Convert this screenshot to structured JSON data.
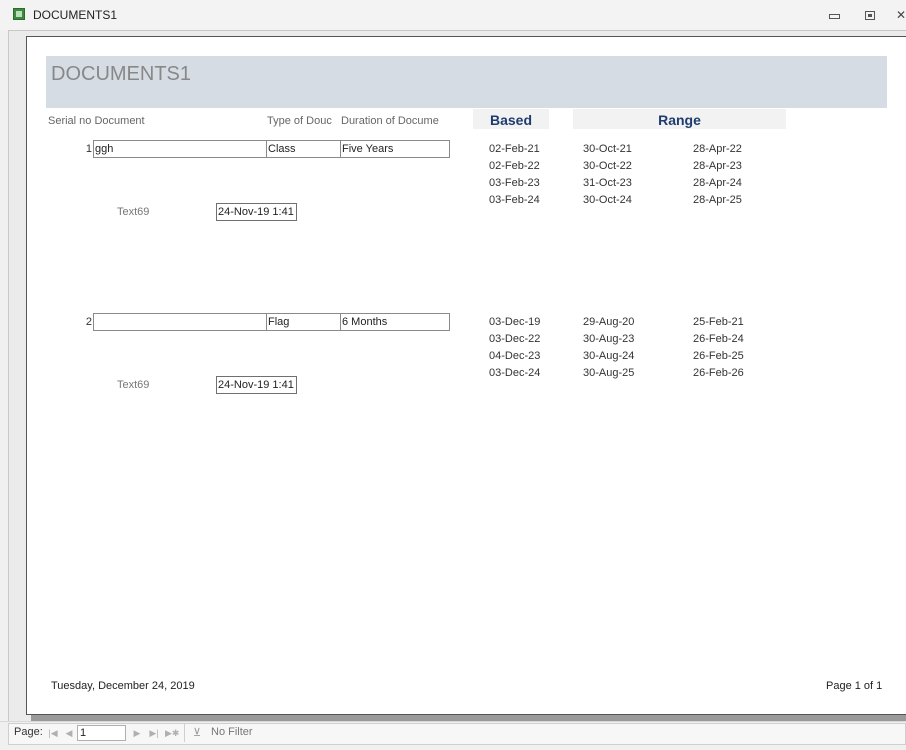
{
  "window": {
    "title": "DOCUMENTS1"
  },
  "report": {
    "title": "DOCUMENTS1",
    "columns": {
      "serial_document": "Serial no Document",
      "type": "Type of Douc",
      "duration": "Duration of Docume",
      "based": "Based",
      "range": "Range"
    },
    "records": [
      {
        "serial": "1",
        "document": "ggh",
        "type": "Class",
        "duration": "Five Years",
        "dates": [
          {
            "based": "02-Feb-21",
            "range_start": "30-Oct-21",
            "range_end": "28-Apr-22"
          },
          {
            "based": "02-Feb-22",
            "range_start": "30-Oct-22",
            "range_end": "28-Apr-23"
          },
          {
            "based": "03-Feb-23",
            "range_start": "31-Oct-23",
            "range_end": "28-Apr-24"
          },
          {
            "based": "03-Feb-24",
            "range_start": "30-Oct-24",
            "range_end": "28-Apr-25"
          }
        ],
        "text_label": "Text69",
        "timestamp": "24-Nov-19 1:41"
      },
      {
        "serial": "2",
        "document": "",
        "type": "Flag",
        "duration": "6 Months",
        "dates": [
          {
            "based": "03-Dec-19",
            "range_start": "29-Aug-20",
            "range_end": "25-Feb-21"
          },
          {
            "based": "03-Dec-22",
            "range_start": "30-Aug-23",
            "range_end": "26-Feb-24"
          },
          {
            "based": "04-Dec-23",
            "range_start": "30-Aug-24",
            "range_end": "26-Feb-25"
          },
          {
            "based": "03-Dec-24",
            "range_start": "30-Aug-25",
            "range_end": "26-Feb-26"
          }
        ],
        "text_label": "Text69",
        "timestamp": "24-Nov-19 1:41"
      }
    ],
    "footer": {
      "date": "Tuesday, December 24, 2019",
      "page": "Page 1 of 1"
    }
  },
  "navigation": {
    "page_label": "Page:",
    "current_page": "1",
    "filter_label": "No Filter",
    "icons": [
      "first-record-icon",
      "previous-record-icon",
      "next-record-icon",
      "last-record-icon",
      "new-record-icon",
      "filter-icon"
    ]
  },
  "colors": {
    "header_band": "#d6dce4",
    "band_header_text": "#1f3c6e",
    "band_header_bg": "#f2f2f2"
  }
}
